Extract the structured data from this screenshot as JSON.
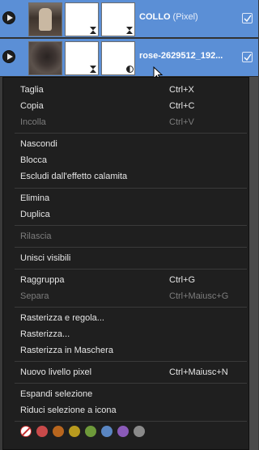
{
  "layers": [
    {
      "name": "COLLO",
      "type": " (Pixel)"
    },
    {
      "name": "rose-2629512_192...",
      "type": ""
    }
  ],
  "menu": {
    "items": [
      {
        "label": "Taglia",
        "shortcut": "Ctrl+X",
        "disabled": false
      },
      {
        "label": "Copia",
        "shortcut": "Ctrl+C",
        "disabled": false
      },
      {
        "label": "Incolla",
        "shortcut": "Ctrl+V",
        "disabled": true
      },
      {
        "label": "Nascondi",
        "shortcut": "",
        "disabled": false
      },
      {
        "label": "Blocca",
        "shortcut": "",
        "disabled": false
      },
      {
        "label": "Escludi dall'effetto calamita",
        "shortcut": "",
        "disabled": false
      },
      {
        "label": "Elimina",
        "shortcut": "",
        "disabled": false
      },
      {
        "label": "Duplica",
        "shortcut": "",
        "disabled": false
      },
      {
        "label": "Rilascia",
        "shortcut": "",
        "disabled": true
      },
      {
        "label": "Unisci visibili",
        "shortcut": "",
        "disabled": false
      },
      {
        "label": "Raggruppa",
        "shortcut": "Ctrl+G",
        "disabled": false
      },
      {
        "label": "Separa",
        "shortcut": "Ctrl+Maiusc+G",
        "disabled": true
      },
      {
        "label": "Rasterizza e regola...",
        "shortcut": "",
        "disabled": false
      },
      {
        "label": "Rasterizza...",
        "shortcut": "",
        "disabled": false
      },
      {
        "label": "Rasterizza in Maschera",
        "shortcut": "",
        "disabled": false
      },
      {
        "label": "Nuovo livello pixel",
        "shortcut": "Ctrl+Maiusc+N",
        "disabled": false
      },
      {
        "label": "Espandi selezione",
        "shortcut": "",
        "disabled": false
      },
      {
        "label": "Riduci selezione a icona",
        "shortcut": "",
        "disabled": false
      }
    ],
    "tag_colors": [
      "none",
      "#c94a4a",
      "#b8661e",
      "#b89a1e",
      "#6e9a3a",
      "#5a86c2",
      "#8a5ab8",
      "#8a8a8a"
    ]
  }
}
